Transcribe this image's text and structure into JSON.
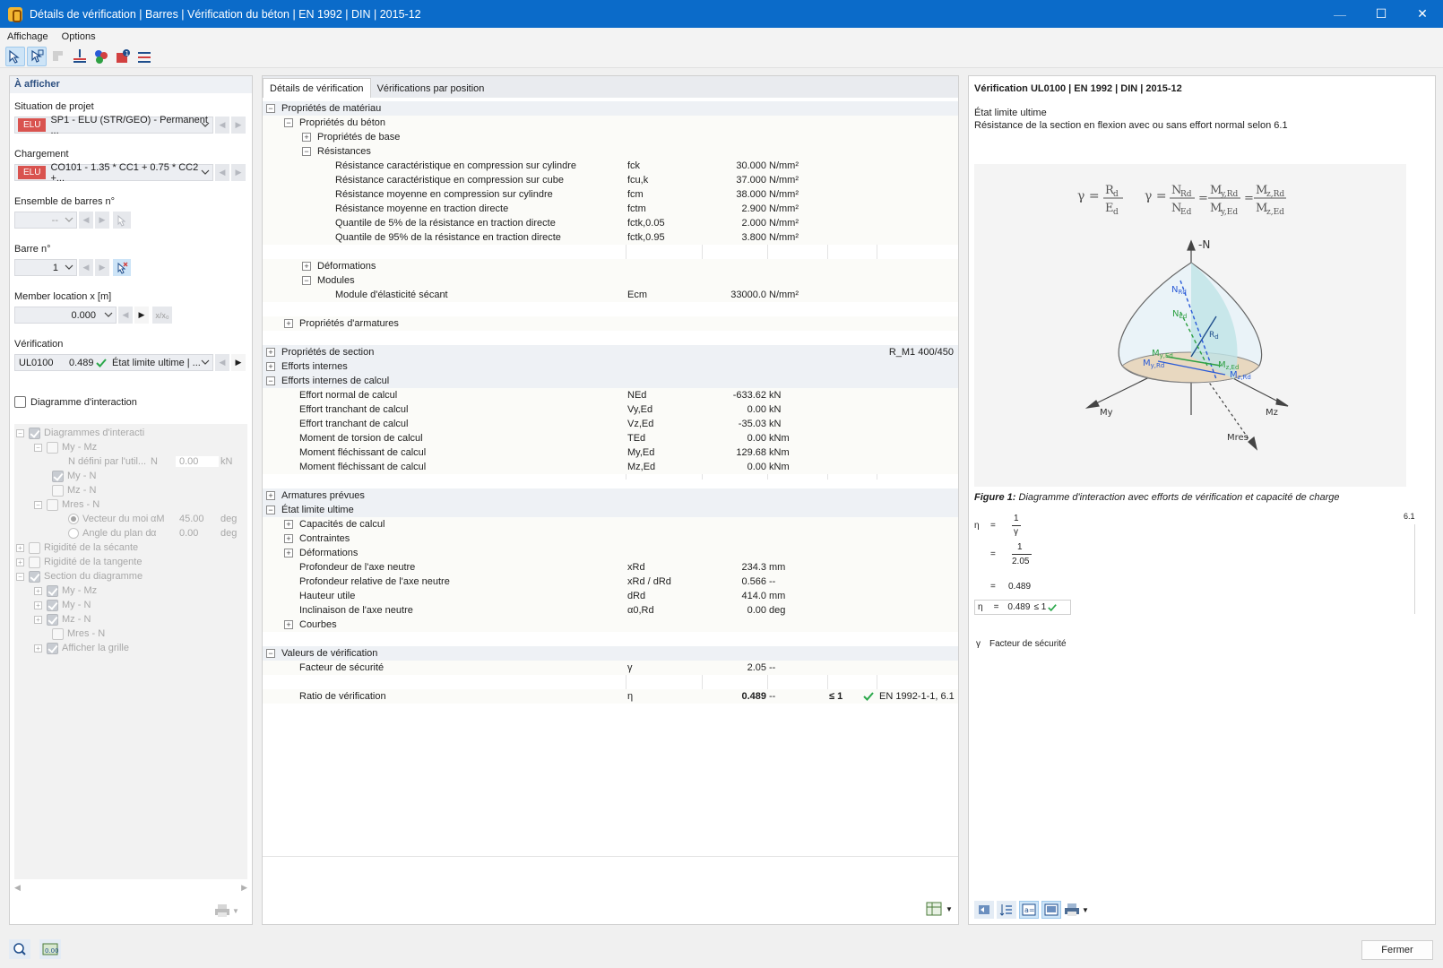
{
  "window": {
    "title": "Détails de vérification | Barres | Vérification du béton | EN 1992 | DIN | 2015-12",
    "minimize": "—",
    "maximize": "☐",
    "close": "✕"
  },
  "menu": [
    "Affichage",
    "Options"
  ],
  "left": {
    "header": "À afficher",
    "project_situation_label": "Situation de projet",
    "project_situation_tag": "ELU",
    "project_situation_value": "SP1 - ELU (STR/GEO) - Permanent ...",
    "loading_label": "Chargement",
    "loading_tag": "ELU",
    "loading_value": "CO101 - 1.35 * CC1 + 0.75 * CC2 +...",
    "member_set_label": "Ensemble de barres n°",
    "member_set_value": "--",
    "member_label": "Barre n°",
    "member_value": "1",
    "location_label": "Member location x [m]",
    "location_value": "0.000",
    "location_ratio": "x/x₀",
    "verification_label": "Vérification",
    "verification_id": "UL0100",
    "verification_ratio": "0.489",
    "verification_desc": "État limite ultime | ...",
    "interaction_checkbox": "Diagramme d'interaction",
    "tree": {
      "diagrams": "Diagrammes d'interacti",
      "my_mz": "My - Mz",
      "n_defined": "N défini par l'util...",
      "n_sym": "N",
      "n_val": "0.00",
      "n_unit": "kN",
      "my_n": "My - N",
      "mz_n": "Mz - N",
      "mres_n": "Mres - N",
      "vector": "Vecteur du moi",
      "vector_sym": "αM",
      "vector_val": "45.00",
      "vector_unit": "deg",
      "angle": "Angle du plan d",
      "angle_sym": "α",
      "angle_val": "0.00",
      "angle_unit": "deg",
      "secant": "Rigidité de la sécante",
      "tangent": "Rigidité de la tangente",
      "section": "Section du diagramme",
      "s_my_mz": "My - Mz",
      "s_my_n": "My - N",
      "s_mz_n": "Mz - N",
      "s_mres_n": "Mres - N",
      "grid": "Afficher la grille"
    }
  },
  "tabs": [
    "Détails de vérification",
    "Vérifications par position"
  ],
  "grid": {
    "mat_props": "Propriétés de matériau",
    "concrete_props": "Propriétés du béton",
    "basic_props": "Propriétés de base",
    "strengths": "Résistances",
    "strength_rows": [
      {
        "label": "Résistance caractéristique en compression sur cylindre",
        "sym": "fck",
        "val": "30.000",
        "unit": "N/mm²"
      },
      {
        "label": "Résistance caractéristique en compression sur cube",
        "sym": "fcu,k",
        "val": "37.000",
        "unit": "N/mm²"
      },
      {
        "label": "Résistance moyenne en compression sur cylindre",
        "sym": "fcm",
        "val": "38.000",
        "unit": "N/mm²"
      },
      {
        "label": "Résistance moyenne en traction directe",
        "sym": "fctm",
        "val": "2.900",
        "unit": "N/mm²"
      },
      {
        "label": "Quantile de 5% de la résistance en traction directe",
        "sym": "fctk,0.05",
        "val": "2.000",
        "unit": "N/mm²"
      },
      {
        "label": "Quantile de 95% de la résistance en traction directe",
        "sym": "fctk,0.95",
        "val": "3.800",
        "unit": "N/mm²"
      }
    ],
    "deformations": "Déformations",
    "modules": "Modules",
    "secant_modulus": {
      "label": "Module d'élasticité sécant",
      "sym": "Ecm",
      "val": "33000.0",
      "unit": "N/mm²"
    },
    "reinf_props": "Propriétés d'armatures",
    "section_props": "Propriétés de section",
    "section_name": "R_M1 400/450",
    "internal_forces": "Efforts internes",
    "design_forces": "Efforts internes de calcul",
    "force_rows": [
      {
        "label": "Effort normal de calcul",
        "sym": "NEd",
        "val": "-633.62",
        "unit": "kN"
      },
      {
        "label": "Effort tranchant de calcul",
        "sym": "Vy,Ed",
        "val": "0.00",
        "unit": "kN"
      },
      {
        "label": "Effort tranchant de calcul",
        "sym": "Vz,Ed",
        "val": "-35.03",
        "unit": "kN"
      },
      {
        "label": "Moment de torsion de calcul",
        "sym": "TEd",
        "val": "0.00",
        "unit": "kNm"
      },
      {
        "label": "Moment fléchissant de calcul",
        "sym": "My,Ed",
        "val": "129.68",
        "unit": "kNm"
      },
      {
        "label": "Moment fléchissant de calcul",
        "sym": "Mz,Ed",
        "val": "0.00",
        "unit": "kNm"
      }
    ],
    "provided_reinf": "Armatures prévues",
    "uls": "État limite ultime",
    "capacities": "Capacités de calcul",
    "stresses": "Contraintes",
    "uls_deformations": "Déformations",
    "uls_rows": [
      {
        "label": "Profondeur de l'axe neutre",
        "sym": "xRd",
        "val": "234.3",
        "unit": "mm"
      },
      {
        "label": "Profondeur relative de l'axe neutre",
        "sym": "xRd / dRd",
        "val": "0.566",
        "unit": "--"
      },
      {
        "label": "Hauteur utile",
        "sym": "dRd",
        "val": "414.0",
        "unit": "mm"
      },
      {
        "label": "Inclinaison de l'axe neutre",
        "sym": "α0,Rd",
        "val": "0.00",
        "unit": "deg"
      }
    ],
    "curves": "Courbes",
    "check_values": "Valeurs de vérification",
    "safety_factor": {
      "label": "Facteur de sécurité",
      "sym": "γ",
      "val": "2.05",
      "unit": "--"
    },
    "ratio": {
      "label": "Ratio de vérification",
      "sym": "η",
      "val": "0.489",
      "unit": "--",
      "limit": "≤ 1",
      "ref": "EN 1992-1-1, 6.1"
    }
  },
  "right": {
    "title": "Vérification UL0100 | EN 1992 | DIN | 2015-12",
    "line1": "État limite ultime",
    "line2": "Résistance de la section en flexion avec ou sans effort normal selon 6.1",
    "figure_caption_bold": "Figure 1:",
    "figure_caption": "Diagramme d'interaction avec efforts de vérification et capacité de charge",
    "eq_ref": "6.1",
    "eta_sym": "η",
    "one": "1",
    "gamma_sym": "γ",
    "gamma_val": "2.05",
    "eta_val": "0.489",
    "eta_box": "0.489",
    "eta_limit": "≤ 1",
    "legend_sym": "γ",
    "legend_text": "Facteur de sécurité",
    "axes": {
      "n": "-N",
      "my": "My",
      "mz": "Mz",
      "mres": "Mres"
    }
  },
  "footer": {
    "close": "Fermer"
  },
  "colors": {
    "titlebar": "#0b6bc9",
    "elu_tag": "#d9534f",
    "check_green": "#2aa84a",
    "blue_force": "#2a5bd7",
    "green_force": "#2ea043"
  }
}
